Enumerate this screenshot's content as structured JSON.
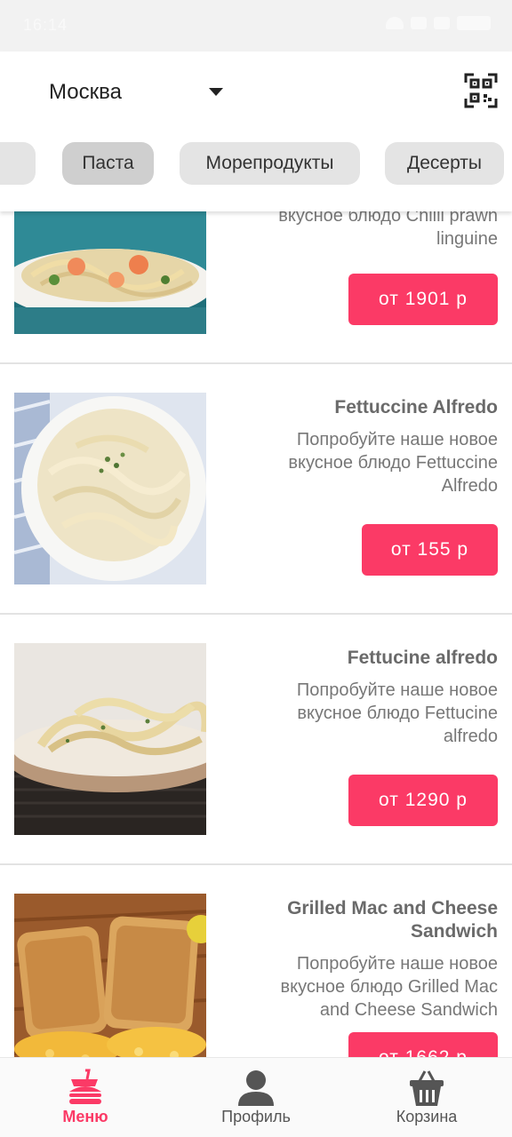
{
  "status_bar": {
    "time": "16:14",
    "battery": "35"
  },
  "header": {
    "city": "Москва",
    "qr_icon": "qr-code-icon"
  },
  "categories": [
    {
      "label": "Паста",
      "active": true
    },
    {
      "label": "Морепродукты",
      "active": false
    },
    {
      "label": "Десерты",
      "active": false
    }
  ],
  "products": [
    {
      "title": "",
      "description_lines": [
        "вкусное блюдо Chilli prawn",
        "linguine"
      ],
      "price": "от 1901 р"
    },
    {
      "title": "Fettuccine Alfredo",
      "description_lines": [
        "Попробуйте наше новое",
        "вкусное блюдо Fettuccine",
        "Alfredo"
      ],
      "price": "от 155 р"
    },
    {
      "title": "Fettucine alfredo",
      "description_lines": [
        "Попробуйте наше новое",
        "вкусное блюдо Fettucine",
        "alfredo"
      ],
      "price": "от 1290 р"
    },
    {
      "title_lines": [
        "Grilled Mac and Cheese",
        "Sandwich"
      ],
      "description_lines": [
        "Попробуйте наше новое",
        "вкусное блюдо Grilled Mac",
        "and Cheese Sandwich"
      ],
      "price": "от 1662 р"
    }
  ],
  "bottom_nav": [
    {
      "label": "Меню",
      "icon": "fast-food-icon",
      "active": true
    },
    {
      "label": "Профиль",
      "icon": "user-icon",
      "active": false
    },
    {
      "label": "Корзина",
      "icon": "basket-icon",
      "active": false
    }
  ],
  "colors": {
    "accent": "#fb3a66",
    "chip": "#e4e4e4",
    "chip_active": "#cfcfcf"
  }
}
